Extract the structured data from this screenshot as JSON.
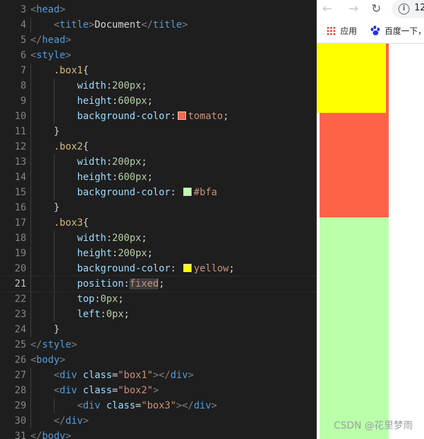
{
  "editor": {
    "lines": [
      {
        "n": "3"
      },
      {
        "n": "4"
      },
      {
        "n": "5"
      },
      {
        "n": "6"
      },
      {
        "n": "7"
      },
      {
        "n": "8"
      },
      {
        "n": "9"
      },
      {
        "n": "10"
      },
      {
        "n": "11"
      },
      {
        "n": "12"
      },
      {
        "n": "13"
      },
      {
        "n": "14"
      },
      {
        "n": "15"
      },
      {
        "n": "16"
      },
      {
        "n": "17"
      },
      {
        "n": "18"
      },
      {
        "n": "19"
      },
      {
        "n": "20"
      },
      {
        "n": "21"
      },
      {
        "n": "22"
      },
      {
        "n": "23"
      },
      {
        "n": "24"
      },
      {
        "n": "25"
      },
      {
        "n": "26"
      },
      {
        "n": "27"
      },
      {
        "n": "28"
      },
      {
        "n": "29"
      },
      {
        "n": "30"
      },
      {
        "n": "31"
      }
    ],
    "code": [
      [
        [
          "<",
          "tk-punc"
        ],
        [
          "head",
          "tk-tag"
        ],
        [
          ">",
          "tk-punc"
        ]
      ],
      [
        [
          "    ",
          ""
        ],
        [
          "<",
          "tk-punc"
        ],
        [
          "title",
          "tk-tag"
        ],
        [
          ">",
          "tk-punc"
        ],
        [
          "Document",
          "tk-text"
        ],
        [
          "</",
          "tk-punc"
        ],
        [
          "title",
          "tk-tag"
        ],
        [
          ">",
          "tk-punc"
        ]
      ],
      [
        [
          "</",
          "tk-punc"
        ],
        [
          "head",
          "tk-tag"
        ],
        [
          ">",
          "tk-punc"
        ]
      ],
      [
        [
          "<",
          "tk-punc"
        ],
        [
          "style",
          "tk-tag"
        ],
        [
          ">",
          "tk-punc"
        ]
      ],
      [
        [
          "    ",
          ""
        ],
        [
          ".box1",
          "tk-sel"
        ],
        [
          "{",
          "tk-text"
        ]
      ],
      [
        [
          "        ",
          ""
        ],
        [
          "width",
          "tk-prop"
        ],
        [
          ":",
          "tk-text"
        ],
        [
          "200px",
          "tk-num"
        ],
        [
          ";",
          "tk-text"
        ]
      ],
      [
        [
          "        ",
          ""
        ],
        [
          "height",
          "tk-prop"
        ],
        [
          ":",
          "tk-text"
        ],
        [
          "600px",
          "tk-num"
        ],
        [
          ";",
          "tk-text"
        ]
      ],
      [
        [
          "        ",
          ""
        ],
        [
          "background-color",
          "tk-prop"
        ],
        [
          ":",
          "tk-text"
        ],
        [
          "#ff6347",
          "swatch"
        ],
        [
          "tomato",
          "tk-val"
        ],
        [
          ";",
          "tk-text"
        ]
      ],
      [
        [
          "    ",
          ""
        ],
        [
          "}",
          "tk-text"
        ]
      ],
      [
        [
          "    ",
          ""
        ],
        [
          ".box2",
          "tk-sel"
        ],
        [
          "{",
          "tk-text"
        ]
      ],
      [
        [
          "        ",
          ""
        ],
        [
          "width",
          "tk-prop"
        ],
        [
          ":",
          "tk-text"
        ],
        [
          "200px",
          "tk-num"
        ],
        [
          ";",
          "tk-text"
        ]
      ],
      [
        [
          "        ",
          ""
        ],
        [
          "height",
          "tk-prop"
        ],
        [
          ":",
          "tk-text"
        ],
        [
          "600px",
          "tk-num"
        ],
        [
          ";",
          "tk-text"
        ]
      ],
      [
        [
          "        ",
          ""
        ],
        [
          "background-color",
          "tk-prop"
        ],
        [
          ": ",
          "tk-text"
        ],
        [
          "#bbffaa",
          "swatch"
        ],
        [
          "#bfa",
          "tk-val"
        ]
      ],
      [
        [
          "    ",
          ""
        ],
        [
          "}",
          "tk-text"
        ]
      ],
      [
        [
          "    ",
          ""
        ],
        [
          ".box3",
          "tk-sel"
        ],
        [
          "{",
          "tk-text"
        ]
      ],
      [
        [
          "        ",
          ""
        ],
        [
          "width",
          "tk-prop"
        ],
        [
          ":",
          "tk-text"
        ],
        [
          "200px",
          "tk-num"
        ],
        [
          ";",
          "tk-text"
        ]
      ],
      [
        [
          "        ",
          ""
        ],
        [
          "height",
          "tk-prop"
        ],
        [
          ":",
          "tk-text"
        ],
        [
          "200px",
          "tk-num"
        ],
        [
          ";",
          "tk-text"
        ]
      ],
      [
        [
          "        ",
          ""
        ],
        [
          "background-color",
          "tk-prop"
        ],
        [
          ": ",
          "tk-text"
        ],
        [
          "#ffff00",
          "swatch"
        ],
        [
          "yellow",
          "tk-val"
        ],
        [
          ";",
          "tk-text"
        ]
      ],
      [
        [
          "        ",
          ""
        ],
        [
          "position",
          "tk-prop"
        ],
        [
          ":",
          "tk-text"
        ],
        [
          "fixed",
          "tk-val tk-hl"
        ],
        [
          ";",
          "tk-text"
        ]
      ],
      [
        [
          "        ",
          ""
        ],
        [
          "top",
          "tk-prop"
        ],
        [
          ":",
          "tk-text"
        ],
        [
          "0px",
          "tk-num"
        ],
        [
          ";",
          "tk-text"
        ]
      ],
      [
        [
          "        ",
          ""
        ],
        [
          "left",
          "tk-prop"
        ],
        [
          ":",
          "tk-text"
        ],
        [
          "0px",
          "tk-num"
        ],
        [
          ";",
          "tk-text"
        ]
      ],
      [
        [
          "    ",
          ""
        ],
        [
          "}",
          "tk-text"
        ]
      ],
      [
        [
          "</",
          "tk-punc"
        ],
        [
          "style",
          "tk-tag"
        ],
        [
          ">",
          "tk-punc"
        ]
      ],
      [
        [
          "<",
          "tk-punc"
        ],
        [
          "body",
          "tk-tag"
        ],
        [
          ">",
          "tk-punc"
        ]
      ],
      [
        [
          "    ",
          ""
        ],
        [
          "<",
          "tk-punc"
        ],
        [
          "div",
          "tk-tag"
        ],
        [
          " ",
          ""
        ],
        [
          "class",
          "tk-attr"
        ],
        [
          "=",
          "tk-text"
        ],
        [
          "\"box1\"",
          "tk-str"
        ],
        [
          "></",
          "tk-punc"
        ],
        [
          "div",
          "tk-tag"
        ],
        [
          ">",
          "tk-punc"
        ]
      ],
      [
        [
          "    ",
          ""
        ],
        [
          "<",
          "tk-punc"
        ],
        [
          "div",
          "tk-tag"
        ],
        [
          " ",
          ""
        ],
        [
          "class",
          "tk-attr"
        ],
        [
          "=",
          "tk-text"
        ],
        [
          "\"box2\"",
          "tk-str"
        ],
        [
          ">",
          "tk-punc"
        ]
      ],
      [
        [
          "        ",
          ""
        ],
        [
          "<",
          "tk-punc"
        ],
        [
          "div",
          "tk-tag"
        ],
        [
          " ",
          ""
        ],
        [
          "class",
          "tk-attr"
        ],
        [
          "=",
          "tk-text"
        ],
        [
          "\"box3\"",
          "tk-str"
        ],
        [
          "></",
          "tk-punc"
        ],
        [
          "div",
          "tk-tag"
        ],
        [
          ">",
          "tk-punc"
        ]
      ],
      [
        [
          "    ",
          ""
        ],
        [
          "</",
          "tk-punc"
        ],
        [
          "div",
          "tk-tag"
        ],
        [
          ">",
          "tk-punc"
        ]
      ],
      [
        [
          "</",
          "tk-punc"
        ],
        [
          "body",
          "tk-tag"
        ],
        [
          ">",
          "tk-punc"
        ]
      ]
    ],
    "current_line": "21"
  },
  "browser": {
    "back_icon": "arrow-left-icon",
    "forward_icon": "arrow-right-icon",
    "reload_icon": "reload-icon",
    "info_icon": "info-icon",
    "info_glyph": "i",
    "url_partial": "12",
    "bookmarks": [
      {
        "icon": "apps-grid-icon",
        "label": "应用"
      },
      {
        "icon": "baidu-paw-icon",
        "label": "百度一下，"
      }
    ]
  },
  "page": {
    "box1_color": "#ff6347",
    "box2_color": "#bbffaa",
    "box3_color": "#ffff00"
  },
  "watermark": "CSDN @花里梦雨"
}
